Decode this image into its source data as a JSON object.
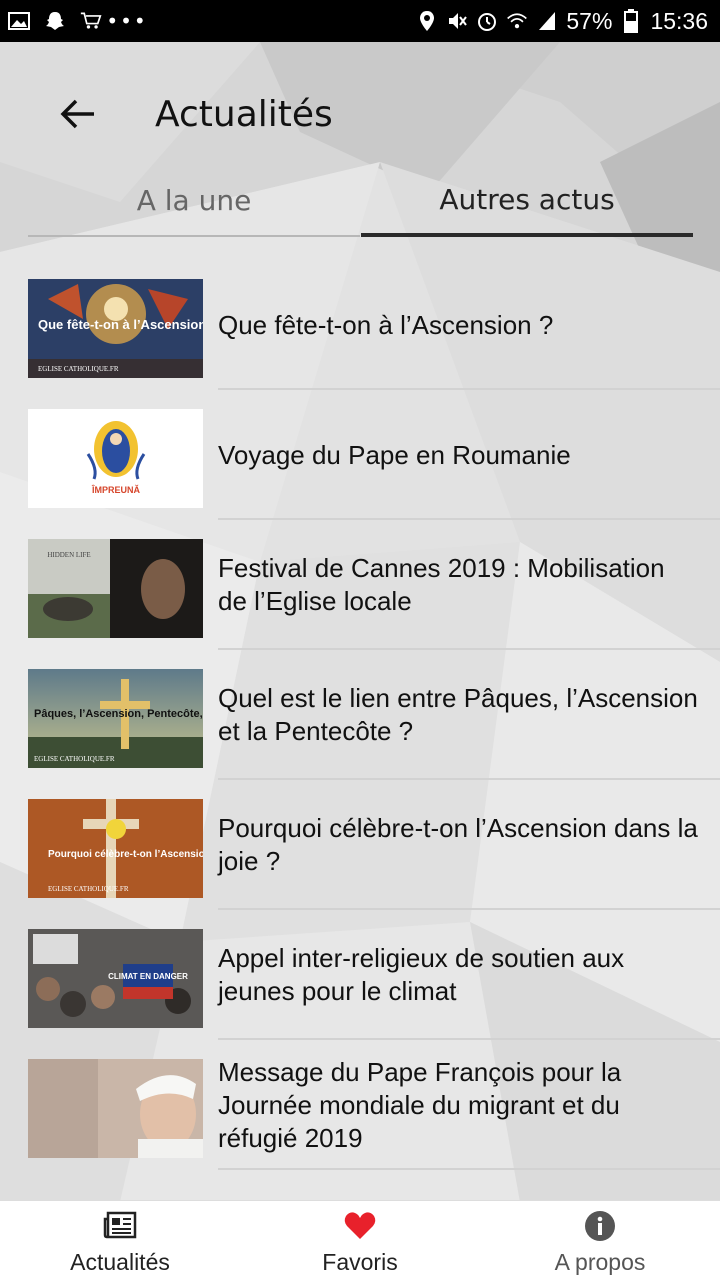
{
  "status_bar": {
    "battery": "57%",
    "time": "15:36",
    "left_icons": [
      "image-icon",
      "snapchat-icon",
      "cart-icon",
      "more-dots-icon"
    ],
    "right_icons": [
      "location-icon",
      "mute-icon",
      "alarm-icon",
      "wifi-icon",
      "signal-icon",
      "battery-icon"
    ]
  },
  "header": {
    "title": "Actualités"
  },
  "tabs": [
    {
      "label": "A la une",
      "active": false
    },
    {
      "label": "Autres actus",
      "active": true
    }
  ],
  "articles": [
    {
      "title": "Que fête-t-on à l’Ascension ?",
      "thumb_text": "Que fête-t-on à l’Ascension ?",
      "thumb_source": "EGLISE CATHOLIQUE.FR"
    },
    {
      "title": "Voyage du Pape en Roumanie",
      "thumb_text": "ÎMPREUNĂ"
    },
    {
      "title": "Festival de Cannes 2019 : Mobilisation de l’Eglise locale",
      "thumb_text": "HIDDEN LIFE"
    },
    {
      "title": "Quel est le lien entre Pâques, l’Ascension et la Pentecôte ?",
      "thumb_text": "Pâques, l’Ascension, Pentecôte, ...",
      "thumb_source": "EGLISE CATHOLIQUE.FR"
    },
    {
      "title": "Pourquoi célèbre-t-on l’Ascension dans la joie ?",
      "thumb_text": "Pourquoi célèbre-t-on l’Ascension dans la joie ?",
      "thumb_source": "EGLISE CATHOLIQUE.FR"
    },
    {
      "title": "Appel inter-religieux de soutien aux jeunes pour le climat",
      "thumb_text": "CLIMAT EN DANGER"
    },
    {
      "title": "Message du Pape François pour la Journée mondiale du migrant et du réfugié 2019"
    }
  ],
  "bottom_nav": [
    {
      "label": "Actualités",
      "icon": "newspaper-icon"
    },
    {
      "label": "Favoris",
      "icon": "heart-icon",
      "color": "#e8212b"
    },
    {
      "label": "A propos",
      "icon": "info-icon"
    }
  ]
}
